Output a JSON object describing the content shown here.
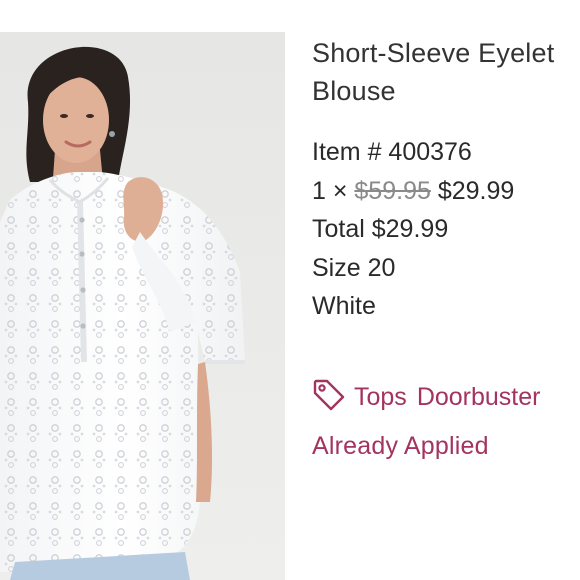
{
  "product": {
    "title_line1": "Short-Sleeve Eyelet",
    "title_line2": "Blouse",
    "item_number": "Item # 400376",
    "quantity_prefix": "1 ×",
    "original_price": "$59.95",
    "sale_price": "$29.99",
    "total": "Total $29.99",
    "size": "Size 20",
    "color": "White"
  },
  "promo": {
    "icon": "tag-icon",
    "category": "Tops",
    "label": "Doorbuster",
    "status": "Already Applied"
  },
  "colors": {
    "accent": "#a3335f",
    "text": "#2d2d2d",
    "strike_price": "#8a8a8a"
  }
}
